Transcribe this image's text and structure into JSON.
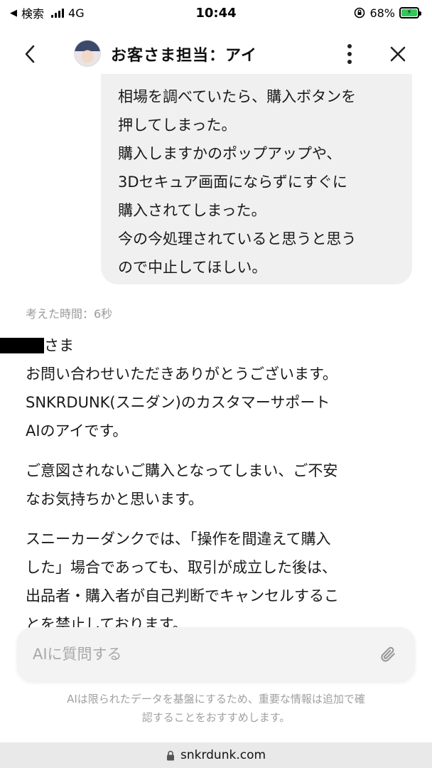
{
  "status_bar": {
    "back_app": "検索",
    "network": "4G",
    "time": "10:44",
    "battery": "68%"
  },
  "header": {
    "title": "お客さま担当：アイ"
  },
  "user_message": {
    "lines": [
      "相場を調べていたら、購入ボタンを",
      "押してしまった。",
      "購入しますかのポップアップや、",
      "3Dセキュア画面にならずにすぐに",
      "購入されてしまった。",
      "今の今処理されていると思うと思う",
      "ので中止してほしい。"
    ]
  },
  "thinking_time": "考えた時間：6秒",
  "reply": {
    "greeting_suffix": "さま",
    "para1": [
      "お問い合わせいただきありがとうございます。",
      "SNKRDUNK(スニダン)のカスタマーサポート",
      "AIのアイです。"
    ],
    "para2": [
      "ご意図されないご購入となってしまい、ご不安",
      "なお気持ちかと思います。"
    ],
    "para3": [
      "スニーカーダンクでは、「操作を間違えて購入",
      "した」場合であっても、取引が成立した後は、",
      "出品者・購入者が自己判断でキャンセルするこ",
      "とを禁止しております。"
    ]
  },
  "input": {
    "placeholder": "AIに質問する"
  },
  "disclaimer": [
    "AIは限られたデータを基盤にするため、重要な情報は追加で確",
    "認することをおすすめします。"
  ],
  "url": "snkrdunk.com",
  "colors": {
    "bubble_bg": "#f0f0f0",
    "input_bg": "#f3f3f3",
    "battery_green": "#33c759",
    "muted_text": "#9a9a9a"
  },
  "icons": [
    "back-triangle-icon",
    "signal-icon",
    "lock-rotation-icon",
    "battery-icon",
    "chevron-left-icon",
    "avatar",
    "kebab-menu-icon",
    "close-icon",
    "paperclip-icon",
    "lock-icon"
  ]
}
